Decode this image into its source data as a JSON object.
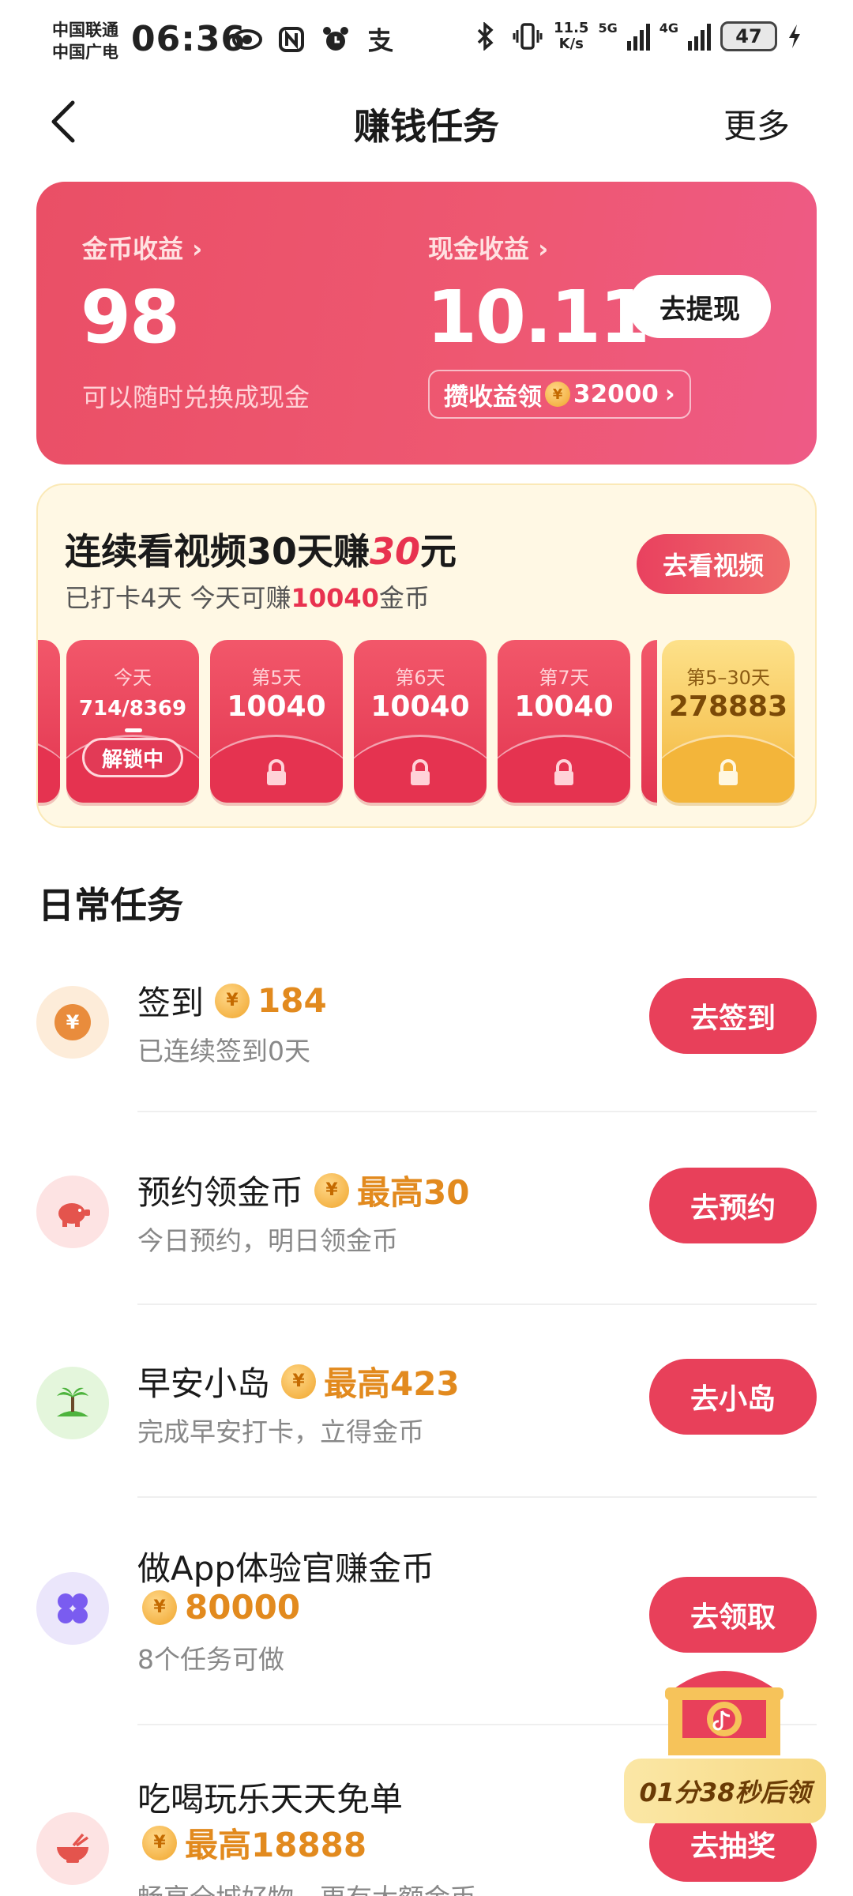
{
  "status_bar": {
    "carrier_1": "中国联通",
    "carrier_2": "中国广电",
    "time": "06:36",
    "net_speed_top": "11.5",
    "net_speed_bottom": "K/s",
    "network_1": "5G",
    "network_2": "4G",
    "battery": "47",
    "icons": [
      "eye-icon",
      "nfc-icon",
      "alarm-icon",
      "alipay-icon",
      "bluetooth-icon",
      "vibrate-icon",
      "signal-icon",
      "charging-icon"
    ]
  },
  "header": {
    "title": "赚钱任务",
    "more": "更多"
  },
  "earnings": {
    "coin_label": "金币收益",
    "coin_value": "98",
    "coin_sub": "可以随时兑换成现金",
    "cash_label": "现金收益",
    "cash_value": "10.11",
    "withdraw_label": "去提现",
    "accumulate_prefix": "攒收益领",
    "accumulate_amount": "32000"
  },
  "streak": {
    "title_prefix": "连续看视频30天赚",
    "title_highlight": "30",
    "title_suffix": "元",
    "sub_prefix": "已打卡4天 今天可赚",
    "sub_amount": "10040",
    "sub_suffix": "金币",
    "watch_label": "去看视频",
    "days": [
      {
        "label": "今天",
        "coins": "714/8369",
        "status": "解锁中"
      },
      {
        "label": "第5天",
        "coins": "10040"
      },
      {
        "label": "第6天",
        "coins": "10040"
      },
      {
        "label": "第7天",
        "coins": "10040"
      },
      {
        "label": "第5–30天",
        "coins": "278883"
      }
    ]
  },
  "daily": {
    "title": "日常任务",
    "tasks": [
      {
        "name": "签到",
        "reward": "184",
        "desc": "已连续签到0天",
        "button": "去签到"
      },
      {
        "name": "预约领金币",
        "reward": "最高30",
        "desc": "今日预约，明日领金币",
        "button": "去预约"
      },
      {
        "name": "早安小岛",
        "reward": "最高423",
        "desc": "完成早安打卡，立得金币",
        "button": "去小岛"
      },
      {
        "name": "做App体验官赚金币",
        "reward": "80000",
        "desc": "8个任务可做",
        "button": "去领取"
      },
      {
        "name": "吃喝玩乐天天免单",
        "reward": "最高18888",
        "desc": "畅享全城好物，更有大额金币",
        "button": "去抽奖"
      }
    ]
  },
  "floating": {
    "timer": "01分38秒后领"
  },
  "colors": {
    "brand_red": "#e8405a",
    "reward_orange": "#e28a1e",
    "cream": "#fff8e4"
  }
}
